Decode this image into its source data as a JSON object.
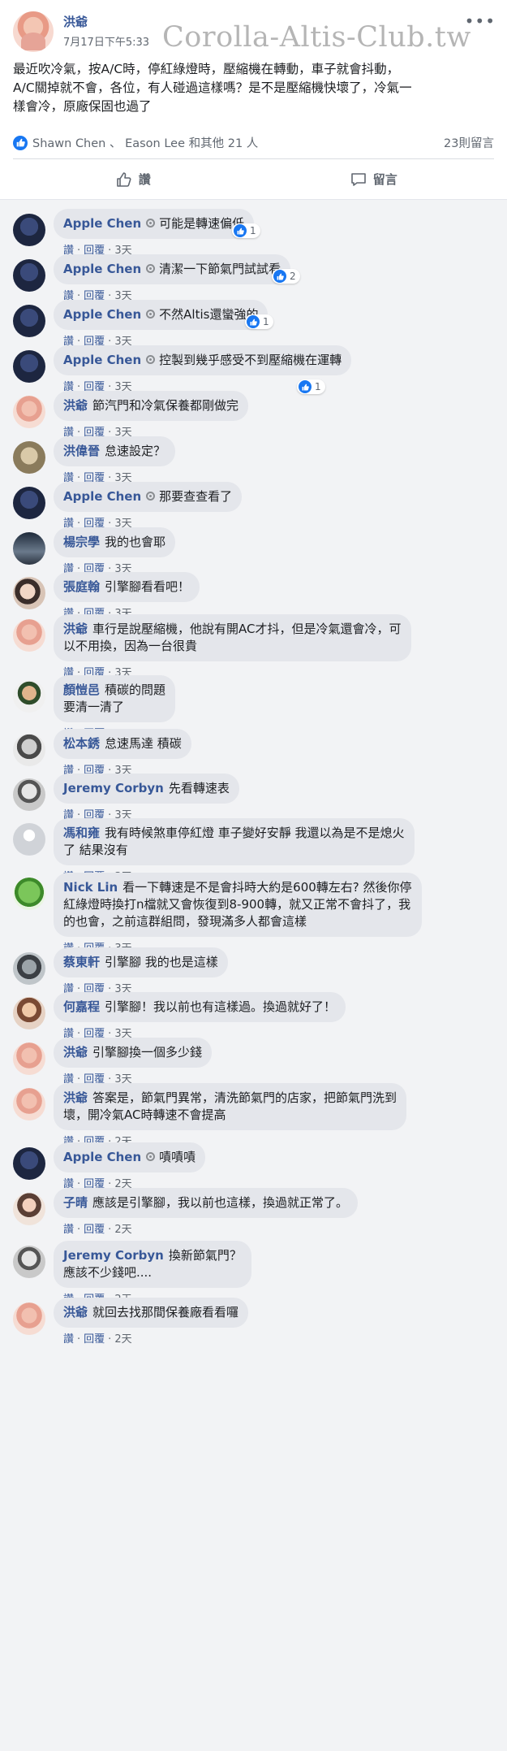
{
  "post": {
    "author": "洪爺",
    "timestamp": "7月17日下午5:33",
    "watermark": "Corolla-Altis-Club.tw",
    "body_lines": [
      "最近吹冷氣，按A/C時，停紅綠燈時，壓縮機在轉動，車子就會抖動，",
      "A/C關掉就不會，各位，有人碰過這樣嗎？是不是壓縮機快壞了，冷氣一",
      "樣會冷，原廠保固也過了"
    ],
    "reactions_names": "Shawn Chen 、 Eason Lee 和其他 21 人",
    "comment_count": "23則留言",
    "like_label": "讚",
    "comment_label": "留言"
  },
  "meta_labels": {
    "like": "讚",
    "reply": "回覆"
  },
  "comments": [
    {
      "name": "Apple Chen",
      "verified": true,
      "lines": [
        "可能是轉速偏低"
      ],
      "time": "3天",
      "reactions": "1"
    },
    {
      "name": "Apple Chen",
      "verified": true,
      "lines": [
        "清潔一下節氣門試試看"
      ],
      "time": "3天",
      "reactions": "2"
    },
    {
      "name": "Apple Chen",
      "verified": true,
      "lines": [
        "不然Altis還蠻強的"
      ],
      "time": "3天",
      "reactions": "1"
    },
    {
      "name": "Apple Chen",
      "verified": true,
      "lines": [
        "控製到幾乎感受不到壓縮機在運轉"
      ],
      "time": "3天",
      "reactions": "1"
    },
    {
      "name": "洪爺",
      "verified": false,
      "lines": [
        "節汽門和冷氣保養都剛做完"
      ],
      "time": "3天",
      "reactions": ""
    },
    {
      "name": "洪偉晉",
      "verified": false,
      "lines": [
        "怠速設定？"
      ],
      "time": "3天",
      "reactions": ""
    },
    {
      "name": "Apple Chen",
      "verified": true,
      "lines": [
        "那要查查看了"
      ],
      "time": "3天",
      "reactions": ""
    },
    {
      "name": "楊宗學",
      "verified": false,
      "lines": [
        "我的也會耶"
      ],
      "time": "3天",
      "reactions": ""
    },
    {
      "name": "張庭翰",
      "verified": false,
      "lines": [
        "引擎腳看看吧！"
      ],
      "time": "3天",
      "reactions": ""
    },
    {
      "name": "洪爺",
      "verified": false,
      "lines": [
        "車行是說壓縮機，他說有開AC才抖，但是冷氣還會冷，可",
        "以不用換，因為一台很貴"
      ],
      "time": "3天",
      "reactions": ""
    },
    {
      "name": "顏愷邑",
      "verified": false,
      "lines": [
        "積碳的問題",
        "要清一清了"
      ],
      "time": "3天",
      "reactions": ""
    },
    {
      "name": "松本銹",
      "verified": false,
      "lines": [
        "怠速馬達 積碳"
      ],
      "time": "3天",
      "reactions": ""
    },
    {
      "name": "Jeremy Corbyn",
      "verified": false,
      "lines": [
        "先看轉速表"
      ],
      "time": "3天",
      "reactions": ""
    },
    {
      "name": "馮和雍",
      "verified": false,
      "lines": [
        "我有時候煞車停紅燈 車子變好安靜 我還以為是不是熄火",
        "了 結果沒有"
      ],
      "time": "3天",
      "reactions": ""
    },
    {
      "name": "Nick Lin",
      "verified": false,
      "lines": [
        "看一下轉速是不是會抖時大約是600轉左右? 然後你停",
        "紅綠燈時換打n檔就又會恢復到8-900轉，就又正常不會抖了，我",
        "的也會，之前這群組問，發現滿多人都會這樣"
      ],
      "time": "3天",
      "reactions": ""
    },
    {
      "name": "蔡東軒",
      "verified": false,
      "lines": [
        "引擎腳 我的也是這樣"
      ],
      "time": "3天",
      "reactions": ""
    },
    {
      "name": "何嘉程",
      "verified": false,
      "lines": [
        "引擎腳！我以前也有這樣過。換過就好了！"
      ],
      "time": "3天",
      "reactions": ""
    },
    {
      "name": "洪爺",
      "verified": false,
      "lines": [
        "引擎腳換一個多少錢"
      ],
      "time": "3天",
      "reactions": ""
    },
    {
      "name": "洪爺",
      "verified": false,
      "lines": [
        "答案是，節氣門異常，清洗節氣門的店家，把節氣門洗到",
        "壞，開冷氣AC時轉速不會提高"
      ],
      "time": "2天",
      "reactions": ""
    },
    {
      "name": "Apple Chen",
      "verified": true,
      "lines": [
        "嘖嘖嘖"
      ],
      "time": "2天",
      "reactions": ""
    },
    {
      "name": "子晴",
      "verified": false,
      "lines": [
        "應該是引擎腳，我以前也這樣，換過就正常了。"
      ],
      "time": "2天",
      "reactions": ""
    },
    {
      "name": "Jeremy Corbyn",
      "verified": false,
      "lines": [
        "換新節氣門？",
        "應該不少錢吧...."
      ],
      "time": "2天",
      "reactions": ""
    },
    {
      "name": "洪爺",
      "verified": false,
      "lines": [
        "就回去找那間保養廠看看囉"
      ],
      "time": "2天",
      "reactions": ""
    }
  ]
}
